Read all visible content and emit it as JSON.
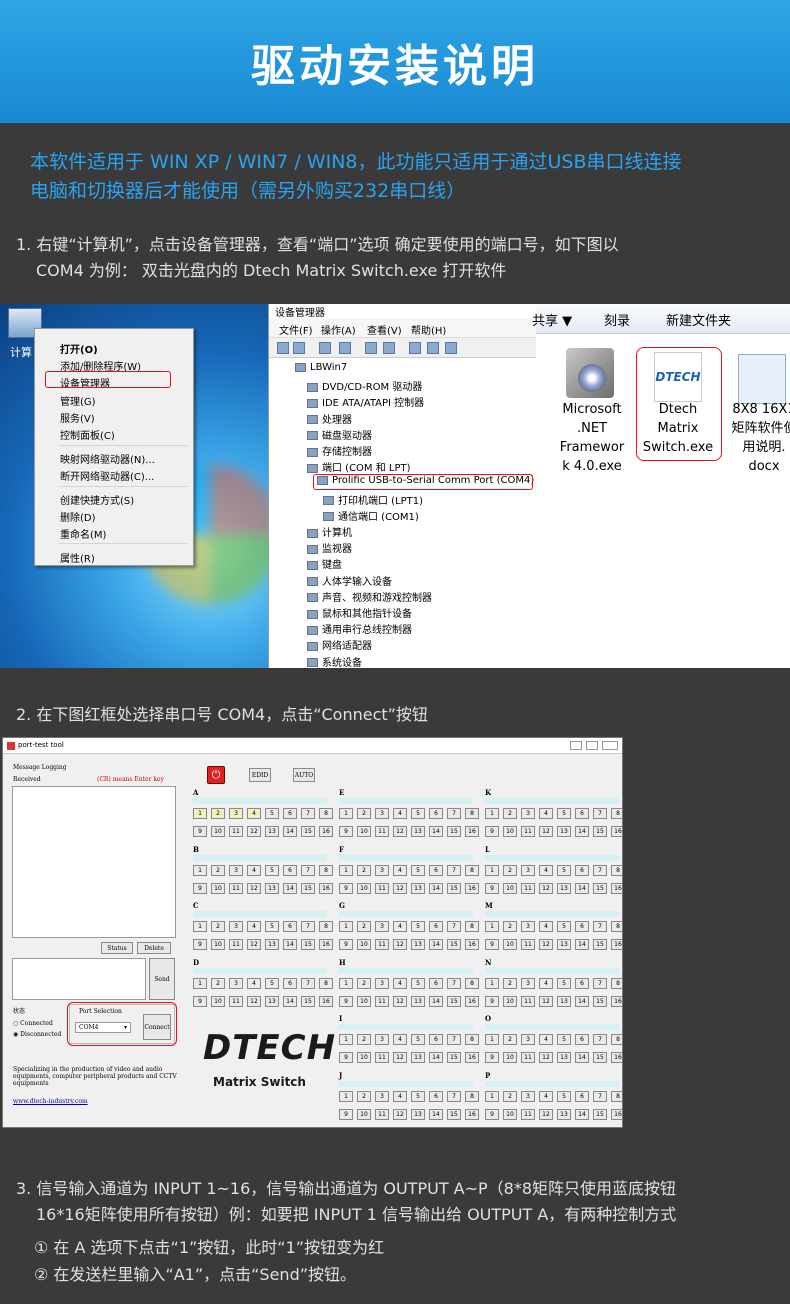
{
  "banner": {
    "title": "驱动安装说明"
  },
  "intro": {
    "line1": "本软件适用于 WIN XP / WIN7 / WIN8，此功能只适用于通过USB串口线连接",
    "line2": "电脑和切换器后才能使用（需另外购买232串口线）"
  },
  "step1": {
    "line1": "1. 右键“计算机”，点击设备管理器，查看“端口”选项 确定要使用的端口号，如下图以",
    "line2": "COM4 为例： 双击光盘内的 Dtech Matrix Switch.exe 打开软件"
  },
  "desktop": {
    "icon_label": "计算",
    "menu": [
      "打开(O)",
      "添加/删除程序(W)",
      "设备管理器",
      "管理(G)",
      "服务(V)",
      "控制面板(C)",
      "映射网络驱动器(N)...",
      "断开网络驱动器(C)...",
      "创建快捷方式(S)",
      "删除(D)",
      "重命名(M)",
      "属性(R)"
    ]
  },
  "devmgr": {
    "title": "设备管理器",
    "menu": [
      "文件(F)",
      "操作(A)",
      "查看(V)",
      "帮助(H)"
    ],
    "tree": [
      "LBWin7",
      "DVD/CD-ROM 驱动器",
      "IDE ATA/ATAPI 控制器",
      "处理器",
      "磁盘驱动器",
      "存储控制器",
      "端口 (COM 和 LPT)",
      "Prolific USB-to-Serial Comm Port (COM4)",
      "打印机端口 (LPT1)",
      "通信端口 (COM1)",
      "计算机",
      "监视器",
      "键盘",
      "人体学输入设备",
      "声音、视频和游戏控制器",
      "鼠标和其他指针设备",
      "通用串行总线控制器",
      "网络适配器",
      "系统设备"
    ]
  },
  "files": {
    "toolbar": [
      "共享 ▼",
      "刻录",
      "新建文件夹"
    ],
    "items": [
      {
        "lines": [
          "Microsoft",
          ".NET",
          "Framewor",
          "k 4.0.exe"
        ]
      },
      {
        "lines": [
          "Dtech",
          "Matrix",
          "Switch.exe"
        ]
      },
      {
        "lines": [
          "8X8 16X1",
          "矩阵软件使",
          "用说明.",
          "docx"
        ]
      }
    ],
    "dtech_logo": "DTECH"
  },
  "step2": {
    "line1": "2. 在下图红框处选择串口号 COM4，点击“Connect”按钮"
  },
  "tool": {
    "title": "port-test tool",
    "msg_logging": "Message Logging",
    "received": "Received",
    "enter_hint": "(CR) means Enter key",
    "status_btn": "Status",
    "delete_btn": "Delete",
    "send_btn": "Send",
    "state_label": "状态",
    "connected": "Connected",
    "disconnected": "Disconnected",
    "port_selection": "Port Selection",
    "port_value": "COM4",
    "connect_btn": "Connect",
    "edid_btn": "EDID",
    "auto_btn": "AUTO",
    "company": "Specializing in the production of video and audio equipments, computer peripheral products and CCTV equipments",
    "url": "www.dtech-industry.com",
    "logo": "DTECH",
    "logo_sub": "Matrix Switch",
    "col1": [
      "A",
      "B",
      "C",
      "D"
    ],
    "col2": [
      "E",
      "F",
      "G",
      "H",
      "I",
      "J"
    ],
    "col3": [
      "K",
      "L",
      "M",
      "N",
      "O",
      "P"
    ],
    "nums": [
      "1",
      "2",
      "3",
      "4",
      "5",
      "6",
      "7",
      "8",
      "9",
      "10",
      "11",
      "12",
      "13",
      "14",
      "15",
      "16"
    ]
  },
  "step3": {
    "line1": "3. 信号输入通道为 INPUT 1~16，信号输出通道为 OUTPUT A~P（8*8矩阵只使用蓝底按钮",
    "line2": "16*16矩阵使用所有按钮）例：如要把 INPUT 1 信号输出给 OUTPUT A，有两种控制方式",
    "opt1": "① 在 A 选项下点击“1”按钮，此时“1”按钮变为红",
    "opt2": "② 在发送栏里输入“A1”，点击“Send”按钮。"
  }
}
